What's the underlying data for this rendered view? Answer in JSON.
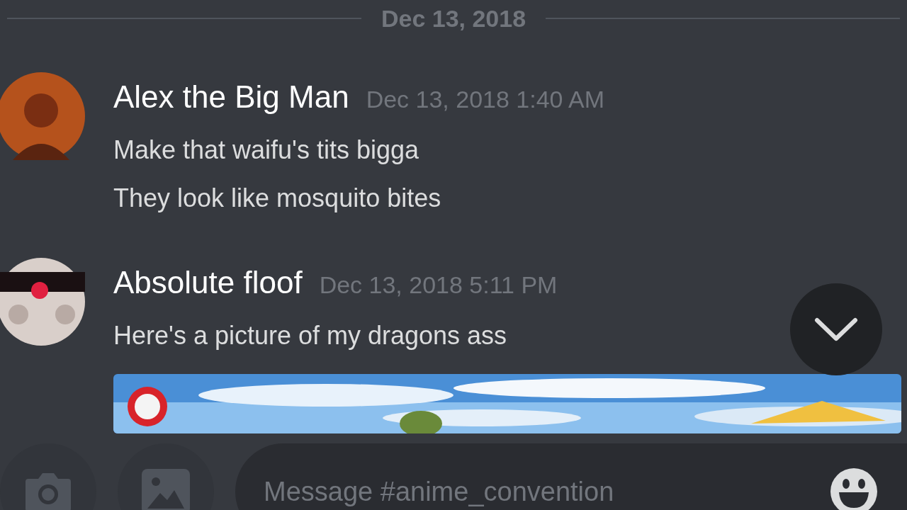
{
  "date_divider": "Dec 13, 2018",
  "messages": [
    {
      "author": "Alex the Big Man",
      "timestamp": "Dec 13, 2018 1:40 AM",
      "lines": [
        "Make that waifu's tits bigga",
        "They look like mosquito bites"
      ]
    },
    {
      "author": "Absolute floof",
      "timestamp": "Dec 13, 2018 5:11 PM",
      "lines": [
        "Here's a picture of my dragons ass"
      ],
      "attachment": {
        "kind": "picture"
      }
    }
  ],
  "composer": {
    "placeholder": "Message #anime_convention"
  }
}
